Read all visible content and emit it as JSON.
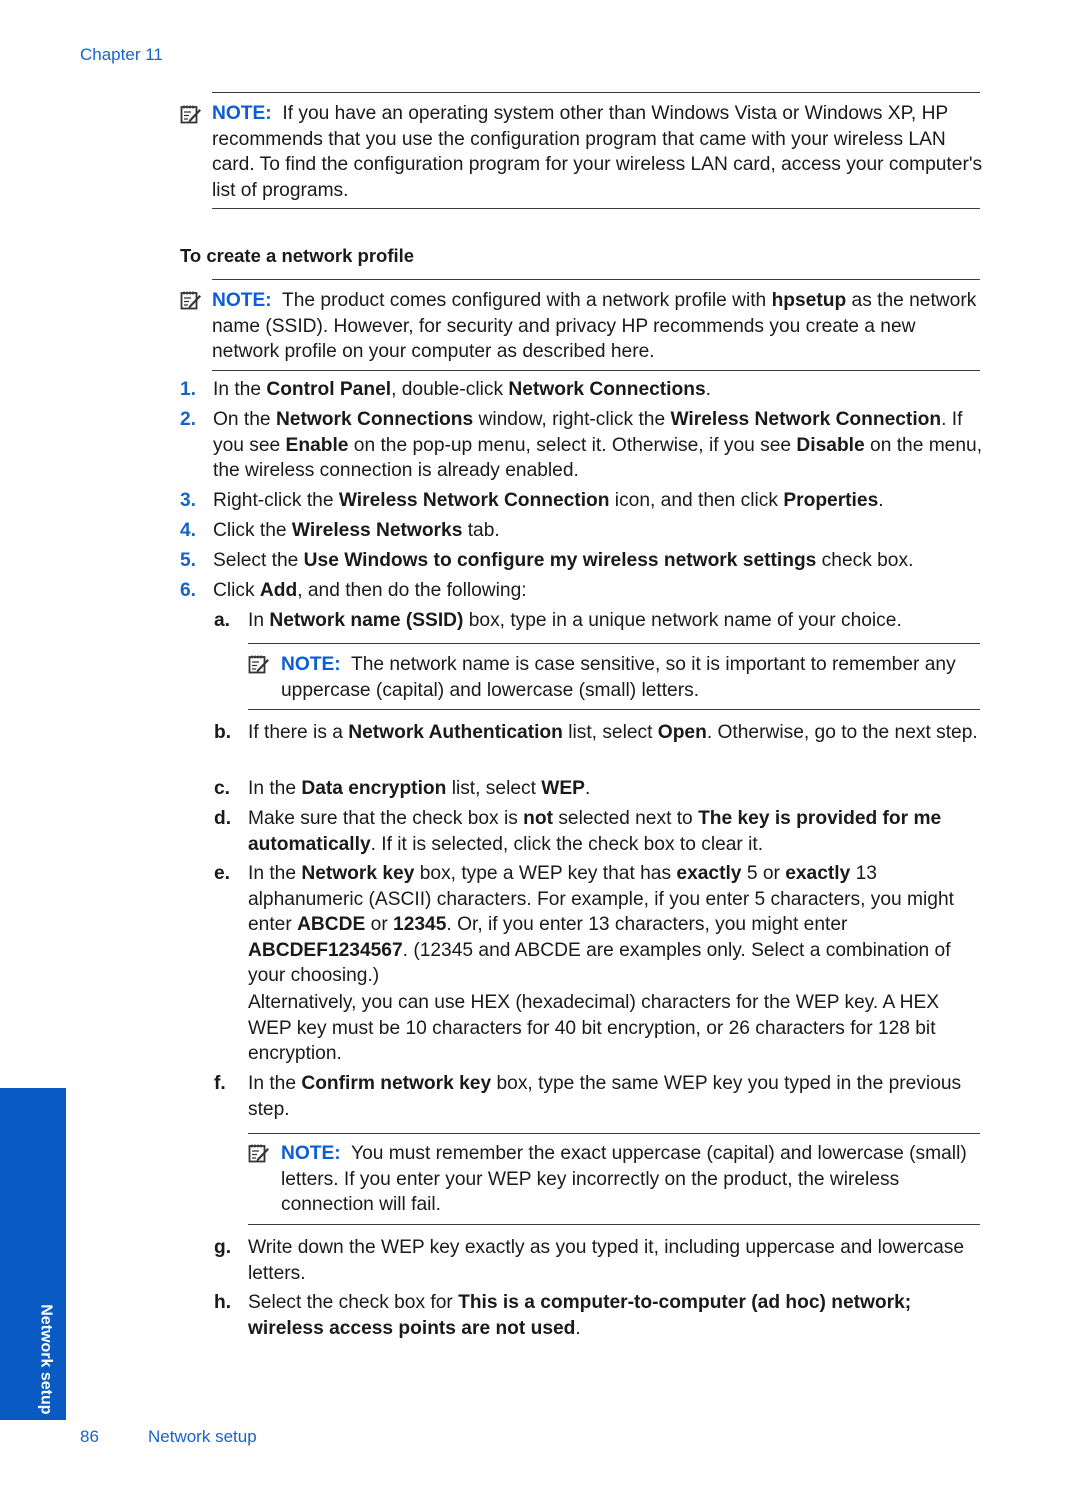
{
  "header": {
    "chapter": "Chapter 11"
  },
  "note1": {
    "label": "NOTE:",
    "text": "If you have an operating system other than Windows Vista or Windows XP, HP recommends that you use the configuration program that came with your wireless LAN card. To find the configuration program for your wireless LAN card, access your computer's list of programs."
  },
  "section_heading": "To create a network profile",
  "note2": {
    "label": "NOTE:",
    "text_before": "The product comes configured with a network profile with",
    "bold": "hpsetup",
    "text_after": "as the network name (SSID). However, for security and privacy HP recommends you create a new network profile on your computer as described here."
  },
  "steps": [
    {
      "num": "1.",
      "parts": [
        [
          "In the ",
          false
        ],
        [
          "Control Panel",
          true
        ],
        [
          ", double-click ",
          false
        ],
        [
          "Network Connections",
          true
        ],
        [
          ".",
          false
        ]
      ]
    },
    {
      "num": "2.",
      "parts": [
        [
          "On the ",
          false
        ],
        [
          "Network Connections",
          true
        ],
        [
          " window, right-click the ",
          false
        ],
        [
          "Wireless Network Connection",
          true
        ],
        [
          ". If you see ",
          false
        ],
        [
          "Enable",
          true
        ],
        [
          " on the pop-up menu, select it. Otherwise, if you see ",
          false
        ],
        [
          "Disable",
          true
        ],
        [
          " on the menu, the wireless connection is already enabled.",
          false
        ]
      ]
    },
    {
      "num": "3.",
      "parts": [
        [
          "Right-click the ",
          false
        ],
        [
          "Wireless Network Connection",
          true
        ],
        [
          " icon, and then click ",
          false
        ],
        [
          "Properties",
          true
        ],
        [
          ".",
          false
        ]
      ]
    },
    {
      "num": "4.",
      "parts": [
        [
          "Click the ",
          false
        ],
        [
          "Wireless Networks",
          true
        ],
        [
          " tab.",
          false
        ]
      ]
    },
    {
      "num": "5.",
      "parts": [
        [
          "Select the ",
          false
        ],
        [
          "Use Windows to configure my wireless network settings",
          true
        ],
        [
          " check box.",
          false
        ]
      ]
    },
    {
      "num": "6.",
      "parts": [
        [
          "Click ",
          false
        ],
        [
          "Add",
          true
        ],
        [
          ", and then do the following:",
          false
        ]
      ]
    }
  ],
  "substeps": {
    "a": {
      "letter": "a.",
      "parts": [
        [
          "In ",
          false
        ],
        [
          "Network name (SSID)",
          true
        ],
        [
          " box, type in a unique network name of your choice.",
          false
        ]
      ]
    },
    "b": {
      "letter": "b.",
      "parts": [
        [
          "If there is a ",
          false
        ],
        [
          "Network Authentication",
          true
        ],
        [
          " list, select ",
          false
        ],
        [
          "Open",
          true
        ],
        [
          ". Otherwise, go to the next step.",
          false
        ]
      ]
    },
    "c": {
      "letter": "c.",
      "parts": [
        [
          "In the ",
          false
        ],
        [
          "Data encryption",
          true
        ],
        [
          " list, select ",
          false
        ],
        [
          "WEP",
          true
        ],
        [
          ".",
          false
        ]
      ]
    },
    "d": {
      "letter": "d.",
      "parts": [
        [
          "Make sure that the check box is ",
          false
        ],
        [
          "not",
          true
        ],
        [
          " selected next to ",
          false
        ],
        [
          "The key is provided for me automatically",
          true
        ],
        [
          ". If it is selected, click the check box to clear it.",
          false
        ]
      ]
    },
    "e": {
      "letter": "e.",
      "parts": [
        [
          "In the ",
          false
        ],
        [
          "Network key",
          true
        ],
        [
          " box, type a WEP key that has ",
          false
        ],
        [
          "exactly",
          true
        ],
        [
          " 5 or ",
          false
        ],
        [
          "exactly",
          true
        ],
        [
          " 13 alphanumeric (ASCII) characters. For example, if you enter 5 characters, you might enter ",
          false
        ],
        [
          "ABCDE",
          true
        ],
        [
          " or ",
          false
        ],
        [
          "12345",
          true
        ],
        [
          ". Or, if you enter 13 characters, you might enter ",
          false
        ],
        [
          "ABCDEF1234567",
          true
        ],
        [
          ". (12345 and ABCDE are examples only. Select a combination of your choosing.)",
          false
        ]
      ]
    },
    "e_extra": "Alternatively, you can use HEX (hexadecimal) characters for the WEP key. A HEX WEP key must be 10 characters for 40 bit encryption, or 26 characters for 128 bit encryption.",
    "f": {
      "letter": "f.",
      "parts": [
        [
          "In the ",
          false
        ],
        [
          "Confirm network key",
          true
        ],
        [
          " box, type the same WEP key you typed in the previous step.",
          false
        ]
      ]
    },
    "g": {
      "letter": "g.",
      "parts": [
        [
          "Write down the WEP key exactly as you typed it, including uppercase and lowercase letters.",
          false
        ]
      ]
    },
    "h": {
      "letter": "h.",
      "parts": [
        [
          "Select the check box for ",
          false
        ],
        [
          "This is a computer-to-computer (ad hoc) network; wireless access points are not used",
          true
        ],
        [
          ".",
          false
        ]
      ]
    }
  },
  "note3": {
    "label": "NOTE:",
    "text": "The network name is case sensitive, so it is important to remember any uppercase (capital) and lowercase (small) letters."
  },
  "note4": {
    "label": "NOTE:",
    "text": "You must remember the exact uppercase (capital) and lowercase (small) letters. If you enter your WEP key incorrectly on the product, the wireless connection will fail."
  },
  "side_tab": {
    "label": "Network setup",
    "color": "#0a5ac4"
  },
  "footer": {
    "page_number": "86",
    "title": "Network setup"
  },
  "colors": {
    "accent": "#0b5ed7",
    "text": "#1a1a1a"
  }
}
